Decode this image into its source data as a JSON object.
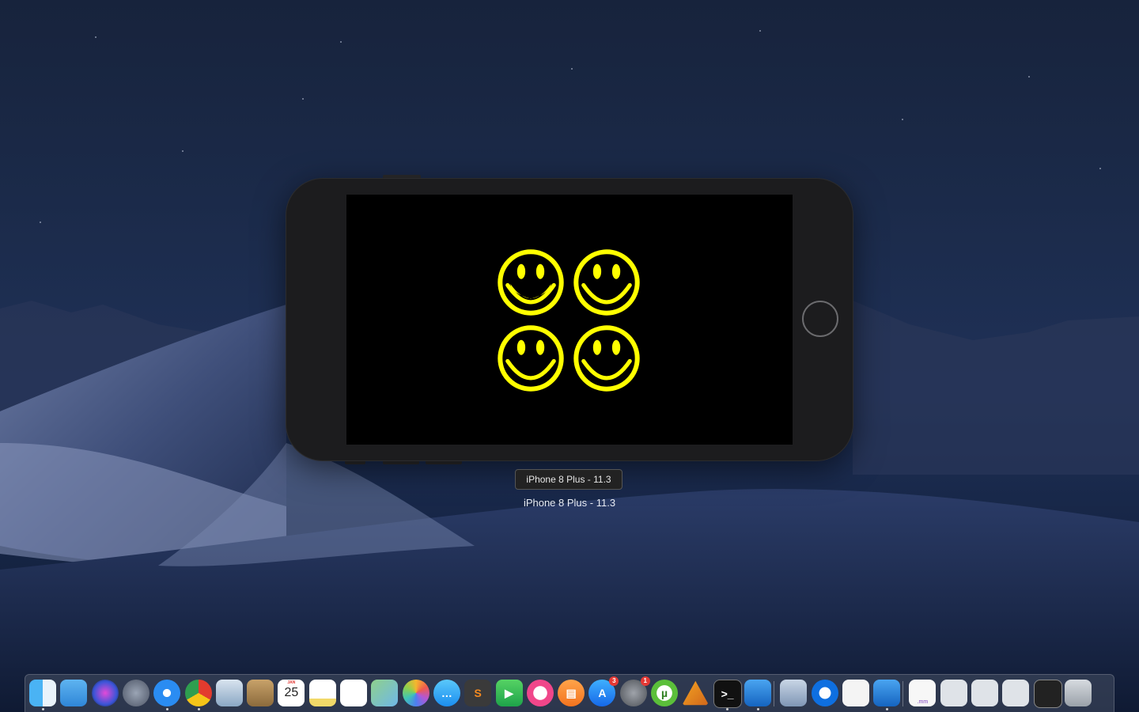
{
  "simulator": {
    "tooltip": "iPhone 8 Plus - 11.3",
    "device_label": "iPhone 8 Plus - 11.3",
    "smiley_color": "#ffff00",
    "screen_background": "#000000",
    "smiley_count": 4
  },
  "dock": {
    "apps": [
      {
        "name": "Finder",
        "icon": "finder-icon",
        "running": true
      },
      {
        "name": "Folder",
        "icon": "folder-icon"
      },
      {
        "name": "Siri",
        "icon": "siri-icon"
      },
      {
        "name": "Launchpad",
        "icon": "launchpad-icon"
      },
      {
        "name": "Safari",
        "icon": "safari-icon",
        "running": true
      },
      {
        "name": "Google Chrome",
        "icon": "chrome-icon",
        "running": true
      },
      {
        "name": "Mail",
        "icon": "mail-icon"
      },
      {
        "name": "Contacts",
        "icon": "contacts-icon"
      },
      {
        "name": "Calendar",
        "icon": "calendar-icon",
        "month": "JAN",
        "day": "25"
      },
      {
        "name": "Notes",
        "icon": "notes-icon"
      },
      {
        "name": "Reminders",
        "icon": "reminders-icon"
      },
      {
        "name": "Maps",
        "icon": "maps-icon"
      },
      {
        "name": "Photos",
        "icon": "photos-icon"
      },
      {
        "name": "Messages",
        "icon": "messages-icon"
      },
      {
        "name": "Sublime Text",
        "icon": "sublime-text-icon"
      },
      {
        "name": "FaceTime",
        "icon": "facetime-icon"
      },
      {
        "name": "iTunes",
        "icon": "itunes-icon"
      },
      {
        "name": "iBooks",
        "icon": "ibooks-icon"
      },
      {
        "name": "App Store",
        "icon": "app-store-icon",
        "badge": "3"
      },
      {
        "name": "System Preferences",
        "icon": "system-preferences-icon",
        "badge": "1"
      },
      {
        "name": "uTorrent",
        "icon": "utorrent-icon"
      },
      {
        "name": "Instruments",
        "icon": "instruments-icon"
      },
      {
        "name": "Terminal",
        "icon": "terminal-icon",
        "running": true
      },
      {
        "name": "Xcode",
        "icon": "xcode-icon",
        "running": true
      },
      {
        "name": "Preview",
        "icon": "preview-icon"
      },
      {
        "name": "TeamViewer",
        "icon": "teamviewer-icon"
      },
      {
        "name": "TextEdit",
        "icon": "textedit-icon"
      },
      {
        "name": "Simulator",
        "icon": "simulator-icon",
        "running": true
      },
      {
        "name": "Document .mm",
        "icon": "document-icon",
        "label": ".mm"
      },
      {
        "name": "Chrome window",
        "icon": "chrome-window-icon"
      },
      {
        "name": "Chrome window 2",
        "icon": "chrome-window-icon"
      },
      {
        "name": "Safari window",
        "icon": "safari-window-icon"
      },
      {
        "name": "Terminal window",
        "icon": "terminal-window-icon"
      },
      {
        "name": "Trash",
        "icon": "trash-icon"
      }
    ]
  }
}
